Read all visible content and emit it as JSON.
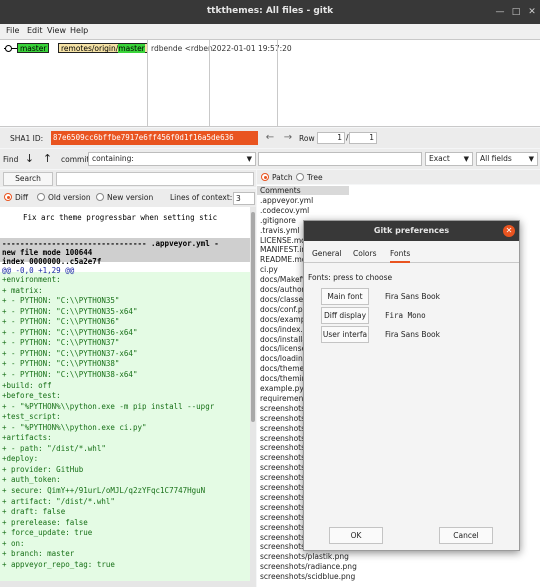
{
  "window": {
    "title": "ttkthemes: All files - gitk"
  },
  "menu": [
    "File",
    "Edit",
    "View",
    "Help"
  ],
  "commit_list": {
    "branch": "master",
    "remote_prefix": "remotes/origin/",
    "remote_branch": "master",
    "author": "rdbende <rdben",
    "date": "2022-01-01 19:57:20"
  },
  "sha": {
    "label": "SHA1 ID:",
    "value": "87e6509cc6bffbe7917e6ff456f0d1f16a5de636",
    "row_label": "Row",
    "row_value": "1",
    "row_separator": "/",
    "row_total": "1"
  },
  "find": {
    "label": "Find",
    "commit_label": "commit",
    "mode": "containing:",
    "match": "Exact",
    "fields": "All fields"
  },
  "search": {
    "button": "Search"
  },
  "diff_options": {
    "diff": "Diff",
    "old": "Old version",
    "new": "New version",
    "context_label": "Lines of context:",
    "context_value": "3"
  },
  "view_options": {
    "patch": "Patch",
    "tree": "Tree"
  },
  "diff": {
    "title": "Fix arc theme progressbar when setting stic",
    "header_line": "-------------------------------- .appveyor.yml -",
    "meta": [
      "new file mode 100644",
      "index 0000000..c5a2e7f"
    ],
    "hunk": "@@ -0,0 +1,29 @@",
    "lines": [
      "+environment:",
      "+  matrix:",
      "+    - PYTHON: \"C:\\\\PYTHON35\"",
      "+    - PYTHON: \"C:\\\\PYTHON35-x64\"",
      "+    - PYTHON: \"C:\\\\PYTHON36\"",
      "+    - PYTHON: \"C:\\\\PYTHON36-x64\"",
      "+    - PYTHON: \"C:\\\\PYTHON37\"",
      "+    - PYTHON: \"C:\\\\PYTHON37-x64\"",
      "+    - PYTHON: \"C:\\\\PYTHON38\"",
      "+    - PYTHON: \"C:\\\\PYTHON38-x64\"",
      "+build: off",
      "+before_test:",
      "+  - \"%PYTHON%\\\\python.exe -m pip install --upgr",
      "+test_script:",
      "+  - \"%PYTHON%\\\\python.exe ci.py\"",
      "+artifacts:",
      "+  - path: \"/dist/*.whl\"",
      "+deploy:",
      "+  provider: GitHub",
      "+  auth_token:",
      "+    secure: QimY++/91urL/oMJL/q2zYFqc1C7747HguN",
      "+  artifact: \"/dist/*.whl\"",
      "+  draft: false",
      "+  prerelease: false",
      "+  force_update: true",
      "+  on:",
      "+    branch: master",
      "+    appveyor_repo_tag: true"
    ]
  },
  "files": [
    "Comments",
    ".appveyor.yml",
    ".codecov.yml",
    ".gitignore",
    ".travis.yml",
    "LICENSE.md",
    "MANIFEST.in",
    "README.md",
    "ci.py",
    "docs/Makefile",
    "docs/authors",
    "docs/classes",
    "docs/conf.py",
    "docs/examples",
    "docs/index.rst",
    "docs/installation",
    "docs/license",
    "docs/loading",
    "docs/themes",
    "docs/theming",
    "example.py",
    "requirements",
    "screenshots/",
    "screenshots/",
    "screenshots/",
    "screenshots/",
    "screenshots/",
    "screenshots/",
    "screenshots/",
    "screenshots/",
    "screenshots/",
    "screenshots/",
    "screenshots/",
    "screenshots/",
    "screenshots/",
    "screenshots/",
    "screenshots/",
    "screenshots/plastik.png",
    "screenshots/radiance.png",
    "screenshots/scidblue.png"
  ],
  "dialog": {
    "title": "Gitk preferences",
    "tabs": [
      "General",
      "Colors",
      "Fonts"
    ],
    "hint": "Fonts: press to choose",
    "fonts": [
      {
        "button": "Main font",
        "value": "Fira Sans Book"
      },
      {
        "button": "Diff display",
        "value": "Fira Mono"
      },
      {
        "button": "User interfa",
        "value": "Fira Sans Book"
      }
    ],
    "ok": "OK",
    "cancel": "Cancel"
  },
  "colors": {
    "accent": "#e95420",
    "titlebar": "#383838",
    "ref_green": "#3ad43a",
    "diff_add_bg": "#e4fbe4"
  }
}
